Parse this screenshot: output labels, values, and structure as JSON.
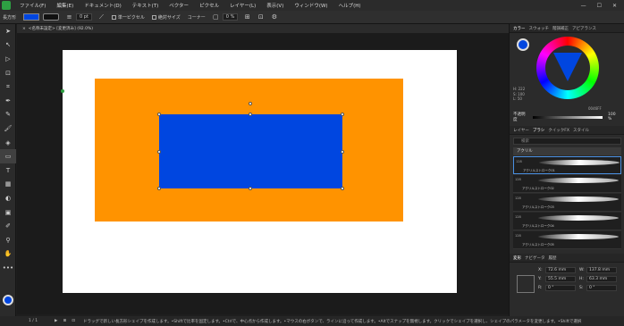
{
  "menubar": {
    "items": [
      "ファイル(F)",
      "編集(E)",
      "ドキュメント(D)",
      "テキスト(T)",
      "ベクター",
      "ピクセル",
      "レイヤー(L)",
      "表示(V)",
      "ウィンドウ(W)",
      "ヘルプ(H)"
    ]
  },
  "context": {
    "tool_label": "長方形",
    "stroke_width": "0 pt",
    "pixel_snap": "単一ピクセル",
    "absolute_size": "絶対サイズ",
    "corner": "コーナー",
    "corner_value": "0 %"
  },
  "document": {
    "tab_title": "<名称未設定> [変更済み] (92.0%)"
  },
  "colors": {
    "fill": "#0046e0",
    "orange": "#ff9300",
    "accent": "#2ea043"
  },
  "right_panel": {
    "tabs": [
      "カラー",
      "スウォッチ",
      "階調補正",
      "アピアランス"
    ],
    "color_info": [
      "H: 222",
      "S: 100",
      "L: 50"
    ],
    "hex": "0046FF",
    "opacity_label": "不透明度",
    "opacity_value": "100 %",
    "brush_tabs": [
      "レイヤー",
      "ブラシ",
      "クイックFX",
      "スタイル"
    ],
    "search_placeholder": "検索",
    "category": "アクリル",
    "brushes": [
      {
        "num": "128",
        "name": "アクリルストローク01"
      },
      {
        "num": "128",
        "name": "アクリルストローク02"
      },
      {
        "num": "128",
        "name": "アクリルストローク03"
      },
      {
        "num": "128",
        "name": "アクリルストローク04"
      },
      {
        "num": "128",
        "name": "アクリルストローク05"
      }
    ],
    "transform_tabs": [
      "変形",
      "ナビゲータ",
      "履歴"
    ],
    "transform": {
      "x": "72.6 mm",
      "y": "55.5 mm",
      "w": "137.8 mm",
      "h": "63.3 mm",
      "r": "0 °",
      "s": "0 °",
      "x_label": "X:",
      "y_label": "Y:",
      "w_label": "W:",
      "h_label": "H:",
      "r_label": "R:",
      "s_label": "S:"
    }
  },
  "statusbar": {
    "page": "1 / 1",
    "message": "ドラッグで新しい長方形シェイプを作成します。•Shiftで比率を固定します。•Ctrlで、中心点から作成します。•マウスの右ボタンで、ラインに沿って作成します。•Altでスナップを無視します。クリックでシェイプを選択し、シェイプのパラメータを変更します。•Shiftで選択"
  }
}
